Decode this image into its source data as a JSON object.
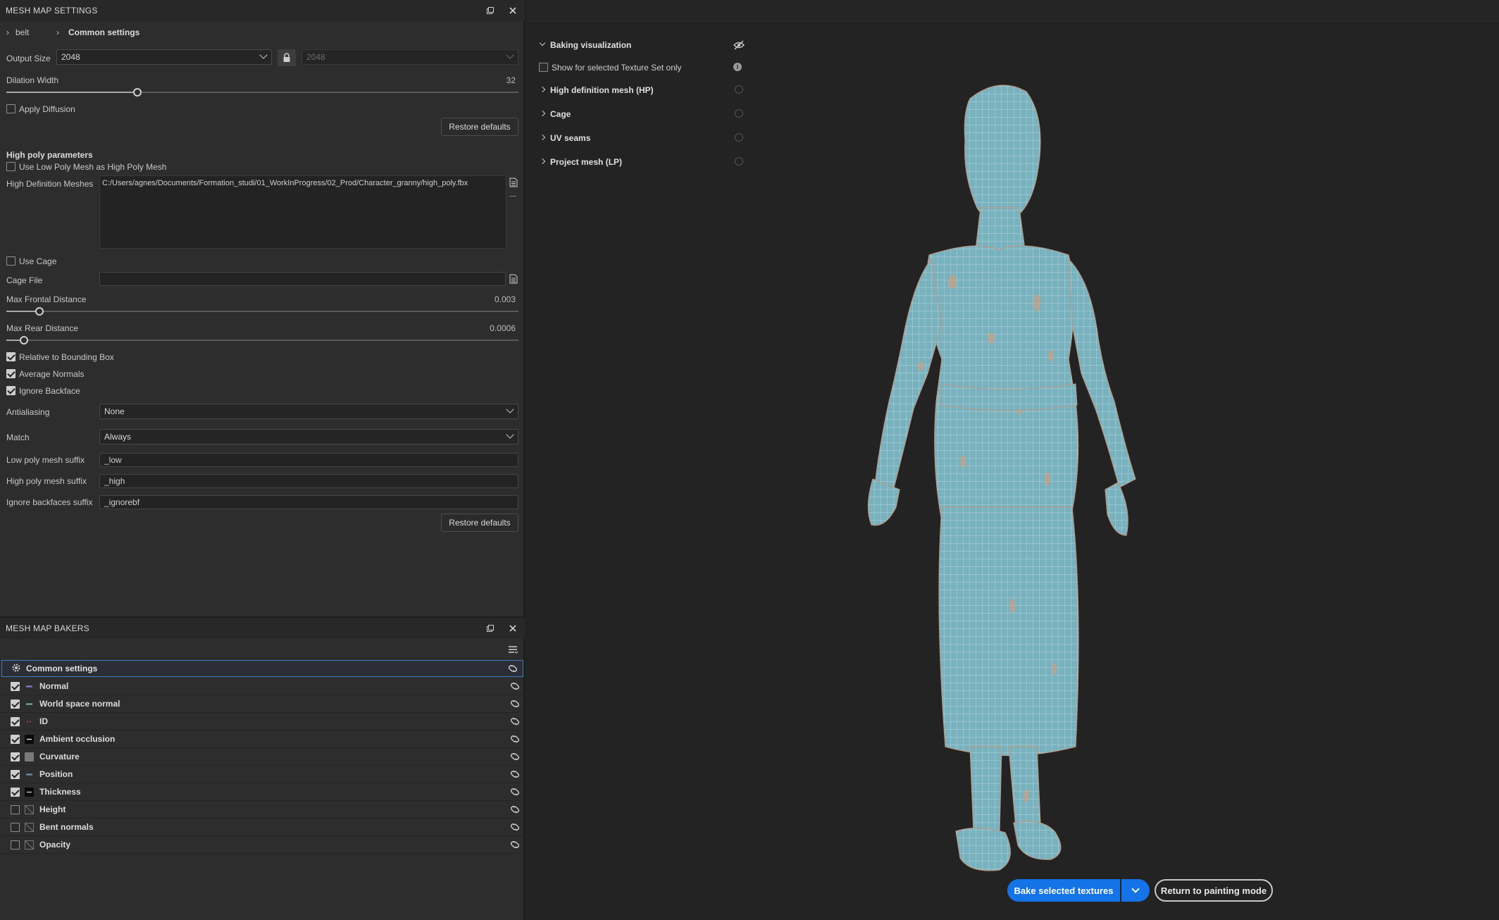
{
  "mesh_map_settings": {
    "title": "MESH MAP SETTINGS",
    "breadcrumb": [
      "belt",
      "Common settings"
    ],
    "output_size_label": "Output Size",
    "output_size_value": "2048",
    "output_size_linked_value": "2048",
    "dilation_width_label": "Dilation Width",
    "dilation_width_value": "32",
    "apply_diffusion_label": "Apply Diffusion",
    "restore_defaults_label": "Restore defaults",
    "high_poly_heading": "High poly parameters",
    "use_low_poly_label": "Use Low Poly Mesh as High Poly Mesh",
    "hd_meshes_label": "High Definition Meshes",
    "hd_meshes_value": "C:/Users/agnes/Documents/Formation_studi/01_WorkInProgress/02_Prod/Character_granny/high_poly.fbx",
    "use_cage_label": "Use Cage",
    "cage_file_label": "Cage File",
    "cage_file_value": "",
    "max_frontal_label": "Max Frontal Distance",
    "max_frontal_value": "0.003",
    "max_rear_label": "Max Rear Distance",
    "max_rear_value": "0.0006",
    "relative_bbox_label": "Relative to Bounding Box",
    "average_normals_label": "Average Normals",
    "ignore_backface_label": "Ignore Backface",
    "antialiasing_label": "Antialiasing",
    "antialiasing_value": "None",
    "match_label": "Match",
    "match_value": "Always",
    "low_suffix_label": "Low poly mesh suffix",
    "low_suffix_value": "_low",
    "high_suffix_label": "High poly mesh suffix",
    "high_suffix_value": "_high",
    "ignore_bf_suffix_label": "Ignore backfaces suffix",
    "ignore_bf_suffix_value": "_ignorebf",
    "checks": {
      "apply_diffusion": false,
      "use_low_poly": false,
      "use_cage": false,
      "relative_bbox": true,
      "average_normals": true,
      "ignore_backface": true
    }
  },
  "mesh_map_bakers": {
    "title": "MESH MAP BAKERS",
    "common_settings_label": "Common settings",
    "items": [
      {
        "label": "Normal",
        "checked": true,
        "thumb": "normal-map"
      },
      {
        "label": "World space normal",
        "checked": true,
        "thumb": "world-normal-map"
      },
      {
        "label": "ID",
        "checked": true,
        "thumb": "id-map"
      },
      {
        "label": "Ambient occlusion",
        "checked": true,
        "thumb": "ao-map"
      },
      {
        "label": "Curvature",
        "checked": true,
        "thumb": "curvature-map"
      },
      {
        "label": "Position",
        "checked": true,
        "thumb": "position-map"
      },
      {
        "label": "Thickness",
        "checked": true,
        "thumb": "thickness-map"
      },
      {
        "label": "Height",
        "checked": false,
        "thumb": "empty-map"
      },
      {
        "label": "Bent normals",
        "checked": false,
        "thumb": "empty-map"
      },
      {
        "label": "Opacity",
        "checked": false,
        "thumb": "empty-map"
      }
    ]
  },
  "baking_visualization": {
    "title": "Baking visualization",
    "show_selected_label": "Show for selected Texture Set only",
    "sections": [
      "High definition mesh (HP)",
      "Cage",
      "UV seams",
      "Project mesh (LP)"
    ]
  },
  "actions": {
    "bake_label": "Bake selected textures",
    "return_label": "Return to painting mode"
  },
  "colors": {
    "accent": "#1473e6",
    "mesh": "#79b2bf",
    "panel": "#2d2d2d",
    "viewport": "#232323"
  }
}
